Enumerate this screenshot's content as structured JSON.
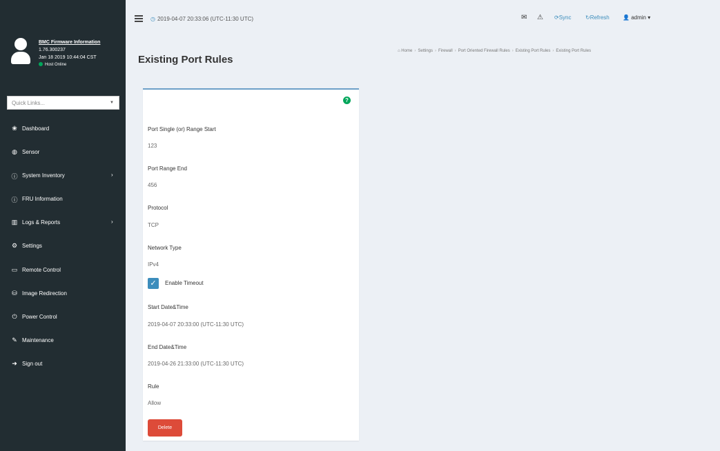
{
  "navbar": {
    "datetime": "2019-04-07 20:33:06 (UTC-11:30 UTC)",
    "sync_label": "Sync",
    "refresh_label": "Refresh",
    "user_label": "admin"
  },
  "sidebar": {
    "firmware_title": "BMC Firmware Information",
    "firmware_version": "1.76.300237",
    "firmware_date": "Jan 18 2019 10:44:04 CST",
    "host_status": "Host Online",
    "quicklinks_placeholder": "Quick Links...",
    "items": [
      {
        "label": "Dashboard",
        "icon": "dashboard-icon",
        "glyph": "❀",
        "has_children": false
      },
      {
        "label": "Sensor",
        "icon": "sensor-icon",
        "glyph": "◍",
        "has_children": false
      },
      {
        "label": "System Inventory",
        "icon": "info-icon",
        "glyph": "ⓘ",
        "has_children": true
      },
      {
        "label": "FRU Information",
        "icon": "info-icon",
        "glyph": "ⓘ",
        "has_children": false
      },
      {
        "label": "Logs & Reports",
        "icon": "chart-icon",
        "glyph": "▥",
        "has_children": true
      },
      {
        "label": "Settings",
        "icon": "gear-icon",
        "glyph": "⚙",
        "has_children": false
      },
      {
        "label": "Remote Control",
        "icon": "monitor-icon",
        "glyph": "▭",
        "has_children": false
      },
      {
        "label": "Image Redirection",
        "icon": "disk-icon",
        "glyph": "⛁",
        "has_children": false
      },
      {
        "label": "Power Control",
        "icon": "power-icon",
        "glyph": "⏻",
        "has_children": false
      },
      {
        "label": "Maintenance",
        "icon": "wrench-icon",
        "glyph": "✎",
        "has_children": false
      },
      {
        "label": "Sign out",
        "icon": "sign-out-icon",
        "glyph": "➜",
        "has_children": false
      }
    ]
  },
  "page": {
    "title": "Existing Port Rules",
    "breadcrumb": [
      "Home",
      "Settings",
      "Firewall",
      "Port Oriented Firewall Rules",
      "Existing Port Rules",
      "Existing Port Rules"
    ]
  },
  "form": {
    "port_start_label": "Port Single (or) Range Start",
    "port_start_value": "123",
    "port_end_label": "Port Range End",
    "port_end_value": "456",
    "protocol_label": "Protocol",
    "protocol_value": "TCP",
    "network_type_label": "Network Type",
    "network_type_value": "IPv4",
    "enable_timeout_label": "Enable Timeout",
    "enable_timeout_checked": true,
    "start_label": "Start Date&Time",
    "start_value": "2019-04-07 20:33:00 (UTC-11:30 UTC)",
    "end_label": "End Date&Time",
    "end_value": "2019-04-26 21:33:00 (UTC-11:30 UTC)",
    "rule_label": "Rule",
    "rule_value": "Allow",
    "delete_label": "Delete"
  },
  "colors": {
    "sidebar_bg": "#222d32",
    "accent": "#3c8dbc",
    "danger": "#dd4b39",
    "success": "#00a65a"
  }
}
